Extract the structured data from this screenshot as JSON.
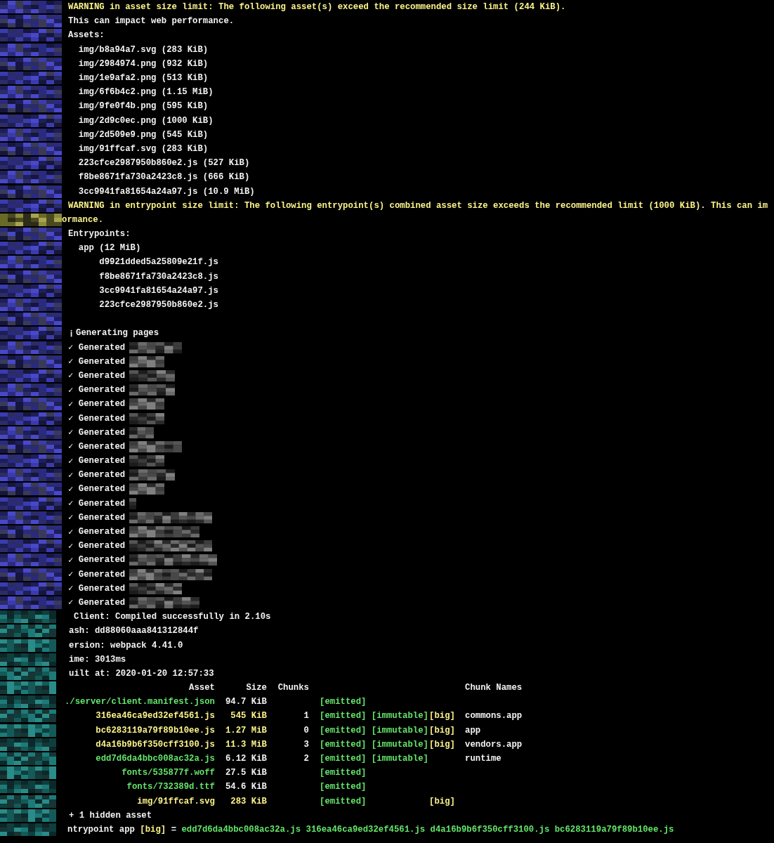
{
  "warnings": [
    {
      "kind": "warning",
      "text": "WARNING in asset size limit: The following asset(s) exceed the recommended size limit (244 KiB)."
    },
    {
      "kind": "plain",
      "text": "This can impact web performance."
    },
    {
      "kind": "plain",
      "text": "Assets:",
      "children": [
        {
          "text": "img/b8a94a7.svg (283 KiB)"
        },
        {
          "text": "img/2984974.png (932 KiB)"
        },
        {
          "text": "img/1e9afa2.png (513 KiB)"
        },
        {
          "text": "img/6f6b4c2.png (1.15 MiB)"
        },
        {
          "text": "img/9fe0f4b.png (595 KiB)"
        },
        {
          "text": "img/2d9c0ec.png (1000 KiB)"
        },
        {
          "text": "img/2d509e9.png (545 KiB)"
        },
        {
          "text": "img/91ffcaf.svg (283 KiB)"
        },
        {
          "text": "223cfce2987950b860e2.js (527 KiB)"
        },
        {
          "text": "f8be8671fa730a2423c8.js (666 KiB)"
        },
        {
          "text": "3cc9941fa81654a24a97.js (10.9 MiB)"
        }
      ]
    },
    {
      "kind": "warning",
      "text": "WARNING in entrypoint size limit: The following entrypoint(s) combined asset size exceeds the recommended limit (1000 KiB). This can im"
    },
    {
      "kind": "continuation",
      "text": "ormance."
    },
    {
      "kind": "plain",
      "text": "Entrypoints:",
      "children": [
        {
          "text": "app (12 MiB)",
          "children": [
            {
              "text": "d9921dded5a25809e21f.js"
            },
            {
              "text": "f8be8671fa730a2423c8.js"
            },
            {
              "text": "3cc9941fa81654a24a97.js"
            },
            {
              "text": "223cfce2987950b860e2.js"
            }
          ]
        }
      ]
    }
  ],
  "pages": {
    "header": {
      "icon": "ℹ",
      "text": "Generating pages"
    },
    "items": [
      {
        "icon": "✓",
        "text": "Generated"
      },
      {
        "icon": "✓",
        "text": "Generated"
      },
      {
        "icon": "✓",
        "text": "Generated"
      },
      {
        "icon": "✓",
        "text": "Generated"
      },
      {
        "icon": "✓",
        "text": "Generated"
      },
      {
        "icon": "✓",
        "text": "Generated"
      },
      {
        "icon": "✓",
        "text": "Generated"
      },
      {
        "icon": "✓",
        "text": "Generated"
      },
      {
        "icon": "✓",
        "text": "Generated"
      },
      {
        "icon": "✓",
        "text": "Generated"
      },
      {
        "icon": "✓",
        "text": "Generated"
      },
      {
        "icon": "✓",
        "text": "Generated"
      },
      {
        "icon": "✓",
        "text": "Generated"
      },
      {
        "icon": "✓",
        "text": "Generated"
      },
      {
        "icon": "✓",
        "text": "Generated"
      },
      {
        "icon": "✓",
        "text": "Generated"
      },
      {
        "icon": "✓",
        "text": "Generated"
      },
      {
        "icon": "✓",
        "text": "Generated"
      },
      {
        "icon": "✓",
        "text": "Generated"
      }
    ]
  },
  "stats": {
    "status": "Client: Compiled successfully in 2.10s",
    "info": [
      "ash: dd88060aaa841312844f",
      "ersion: webpack 4.41.0",
      "ime: 3013ms",
      "uilt at: 2020-01-20 12:57:33"
    ],
    "table": {
      "columns": {
        "asset": "Asset",
        "size": "Size",
        "chunks": "Chunks",
        "chunk_names": "Chunk Names"
      },
      "rows": [
        {
          "asset": "./server/client.manifest.json",
          "size": "94.7 KiB",
          "tags": [
            "[emitted]"
          ]
        },
        {
          "asset": "316ea46ca9ed32ef4561.js",
          "size": "545 KiB",
          "chunks": "1",
          "tags": [
            "[emitted]",
            "[immutable]"
          ],
          "big": "[big]",
          "chunk_names": "commons.app"
        },
        {
          "asset": "bc6283119a79f89b10ee.js",
          "size": "1.27 MiB",
          "chunks": "0",
          "tags": [
            "[emitted]",
            "[immutable]"
          ],
          "big": "[big]",
          "chunk_names": "app"
        },
        {
          "asset": "d4a16b9b6f350cff3100.js",
          "size": "11.3 MiB",
          "chunks": "3",
          "tags": [
            "[emitted]",
            "[immutable]"
          ],
          "big": "[big]",
          "chunk_names": "vendors.app"
        },
        {
          "asset": "edd7d6da4bbc008ac32a.js",
          "size": "6.12 KiB",
          "chunks": "2",
          "tags": [
            "[emitted]",
            "[immutable]"
          ],
          "chunk_names": "runtime"
        },
        {
          "asset": "fonts/535877f.woff",
          "size": "27.5 KiB",
          "tags": [
            "[emitted]"
          ]
        },
        {
          "asset": "fonts/732389d.ttf",
          "size": "54.6 KiB",
          "tags": [
            "[emitted]"
          ]
        },
        {
          "asset": "img/91ffcaf.svg",
          "size": "283 KiB",
          "tags": [
            "[emitted]"
          ],
          "big": "[big]"
        }
      ]
    },
    "hidden": "+ 1 hidden asset",
    "entrypoint": {
      "label": "ntrypoint app",
      "big": "[big]",
      "equals": "=",
      "files": "edd7d6da4bbc008ac32a.js 316ea46ca9ed32ef4561.js d4a16b9b6f350cff3100.js bc6283119a79f89b10ee.js"
    }
  }
}
